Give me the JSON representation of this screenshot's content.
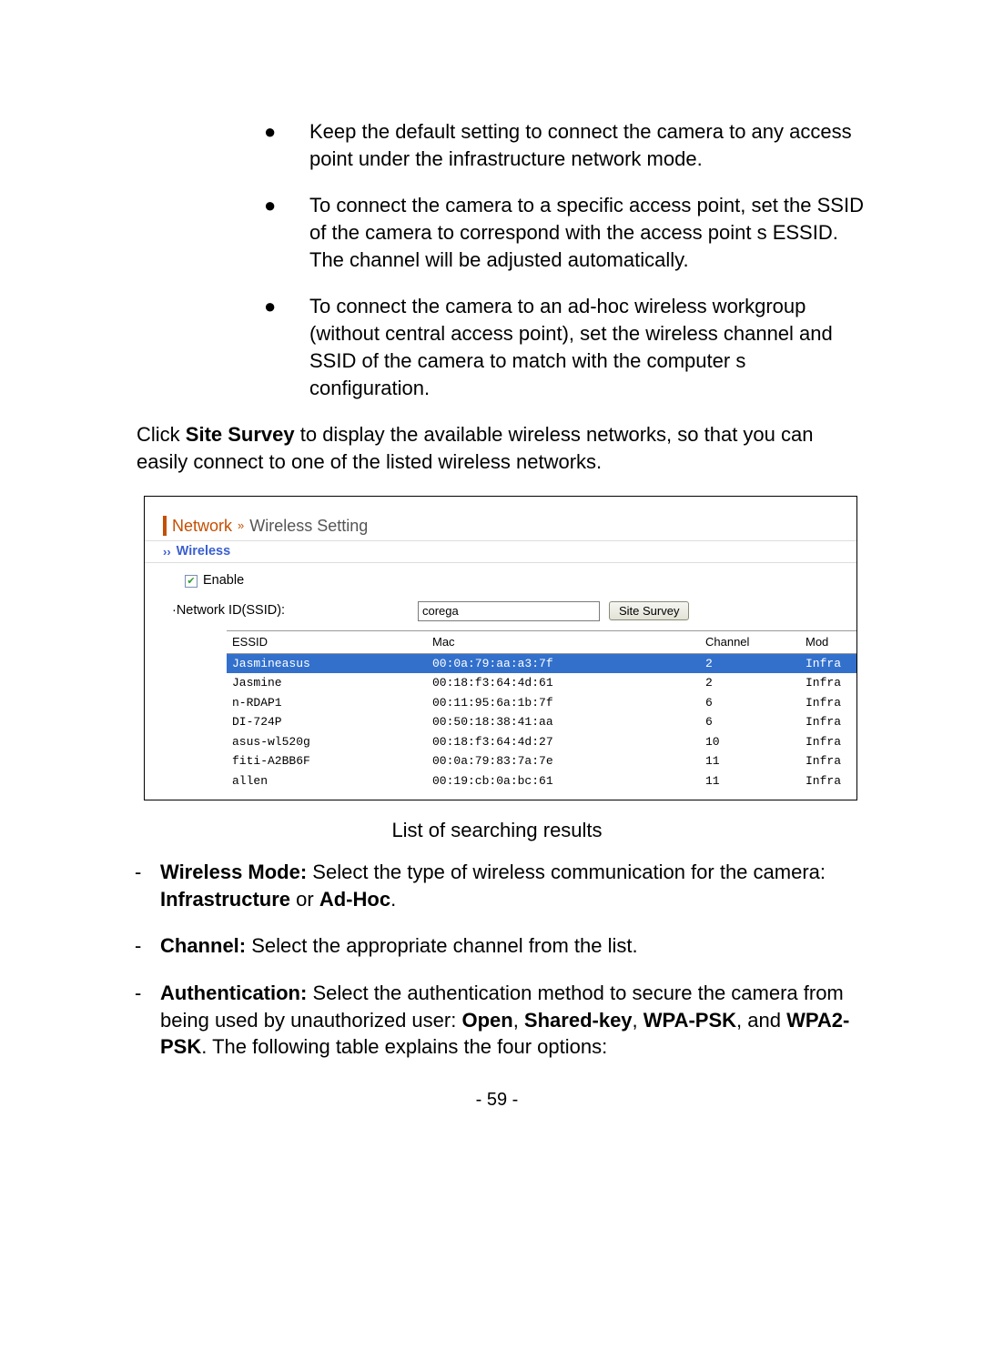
{
  "bullets": [
    "Keep the default setting to connect the camera to any access point under the infrastructure network mode.",
    "To connect the camera to a specific access point, set the SSID of the camera to correspond with the access point s ESSID. The channel will be adjusted automatically.",
    "To connect the camera to an ad-hoc wireless workgroup (without central access point), set the wireless channel and SSID of the camera to match with the computer s configuration."
  ],
  "intro": {
    "before": "Click ",
    "bold": "Site Survey",
    "after": " to display the available wireless networks, so that you can easily connect to one of the listed wireless networks."
  },
  "shot": {
    "title_network": "Network",
    "title_sub": "Wireless Setting",
    "section": "Wireless",
    "enable_label": "Enable",
    "enable_checked": true,
    "ssid_label": "·Network ID(SSID):",
    "ssid_value": "corega",
    "survey_btn": "Site Survey",
    "headers": [
      "ESSID",
      "Mac",
      "Channel",
      "Mod"
    ],
    "rows": [
      {
        "sel": true,
        "essid": "Jasmineasus",
        "mac": "00:0a:79:aa:a3:7f",
        "ch": "2",
        "mode": "Infra"
      },
      {
        "sel": false,
        "essid": "Jasmine",
        "mac": "00:18:f3:64:4d:61",
        "ch": "2",
        "mode": "Infra"
      },
      {
        "sel": false,
        "essid": "n-RDAP1",
        "mac": "00:11:95:6a:1b:7f",
        "ch": "6",
        "mode": "Infra"
      },
      {
        "sel": false,
        "essid": "DI-724P",
        "mac": "00:50:18:38:41:aa",
        "ch": "6",
        "mode": "Infra"
      },
      {
        "sel": false,
        "essid": "asus-wl520g",
        "mac": "00:18:f3:64:4d:27",
        "ch": "10",
        "mode": "Infra"
      },
      {
        "sel": false,
        "essid": "fiti-A2BB6F",
        "mac": "00:0a:79:83:7a:7e",
        "ch": "11",
        "mode": "Infra"
      },
      {
        "sel": false,
        "essid": "allen",
        "mac": "00:19:cb:0a:bc:61",
        "ch": "11",
        "mode": "Infra"
      }
    ]
  },
  "caption": "List of searching results",
  "dashes": [
    {
      "b1": "Wireless Mode:",
      "t1": " Select the type of wireless communication for the camera: ",
      "b2": "Infrastructure",
      "mid": " or ",
      "b3": "Ad-Hoc",
      "tail": "."
    },
    {
      "b1": "Channel:",
      "t1": " Select the appropriate channel from the list."
    },
    {
      "b1": "Authentication:",
      "t1": " Select the authentication method to secure the camera from being used by unauthorized user: ",
      "b2": "Open",
      "mid": ", ",
      "b3": "Shared-key",
      "mid2": ", ",
      "b4": "WPA-PSK",
      "mid3": ", and ",
      "b5": "WPA2-PSK",
      "tail": ". The following table explains the four options:"
    }
  ],
  "page_number": "- 59 -"
}
